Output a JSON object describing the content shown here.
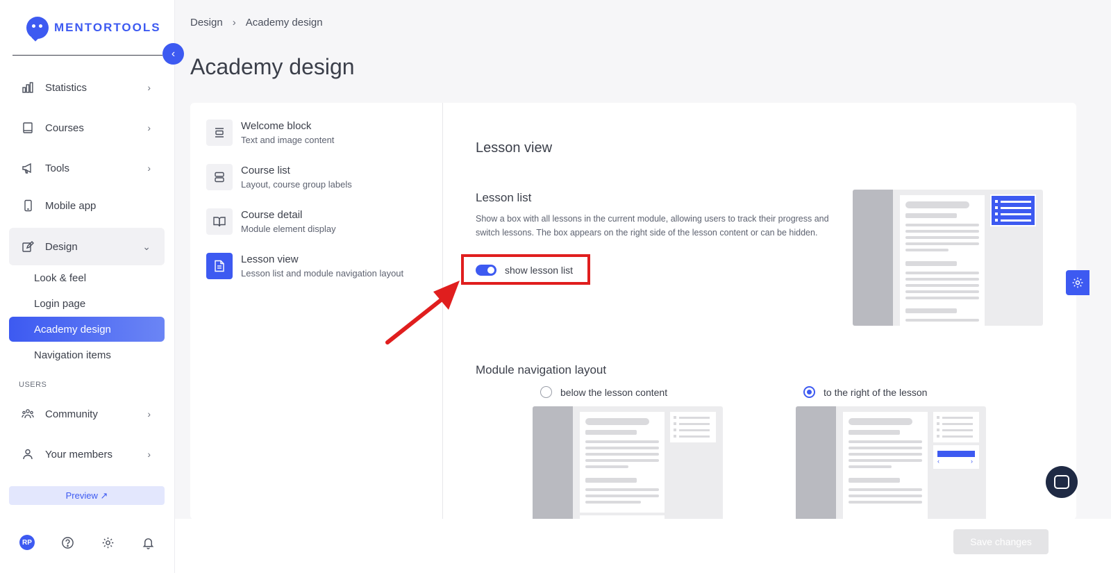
{
  "brand": {
    "name": "MENTORTOOLS"
  },
  "sidebar": {
    "items": [
      {
        "label": "Statistics",
        "icon": "bar-chart-icon"
      },
      {
        "label": "Courses",
        "icon": "book-icon"
      },
      {
        "label": "Tools",
        "icon": "megaphone-icon"
      },
      {
        "label": "Mobile app",
        "icon": "mobile-icon"
      },
      {
        "label": "Design",
        "icon": "pencil-icon"
      }
    ],
    "design_sub": [
      "Look & feel",
      "Login page",
      "Academy design",
      "Navigation items"
    ],
    "users_label": "USERS",
    "user_items": [
      {
        "label": "Community",
        "icon": "community-icon"
      },
      {
        "label": "Your members",
        "icon": "user-icon"
      }
    ],
    "preview_label": "Preview ↗",
    "avatar_initials": "RP"
  },
  "breadcrumb": {
    "parent": "Design",
    "current": "Academy design"
  },
  "page": {
    "title": "Academy design"
  },
  "menu": [
    {
      "title": "Welcome block",
      "sub": "Text and image content"
    },
    {
      "title": "Course list",
      "sub": "Layout, course group labels"
    },
    {
      "title": "Course detail",
      "sub": "Module element display"
    },
    {
      "title": "Lesson view",
      "sub": "Lesson list and module navigation layout"
    }
  ],
  "content": {
    "section_title": "Lesson view",
    "lesson_list_title": "Lesson list",
    "lesson_list_desc": "Show a box with all lessons in the current module, allowing users to track their progress and switch lessons. The box appears on the right side of the lesson content or can be hidden.",
    "toggle_label": "show lesson list",
    "toggle_on": true,
    "module_title": "Module navigation layout",
    "radio_below": "below the lesson content",
    "radio_right": "to the right of the lesson",
    "selected_layout": "right"
  },
  "footer": {
    "save_label": "Save changes"
  },
  "colors": {
    "accent": "#3d5af1",
    "highlight": "#e01e1e"
  }
}
